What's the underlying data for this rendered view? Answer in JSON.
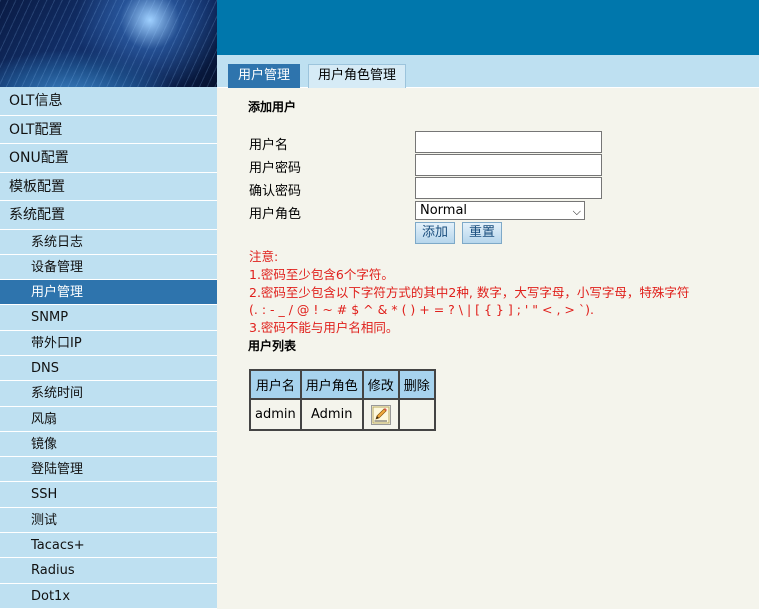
{
  "sidebar": {
    "main_items": [
      "OLT信息",
      "OLT配置",
      "ONU配置",
      "模板配置",
      "系统配置"
    ],
    "sub_items": [
      "系统日志",
      "设备管理",
      "用户管理",
      "SNMP",
      "带外口IP",
      "DNS",
      "系统时间",
      "风扇",
      "镜像",
      "登陆管理",
      "SSH",
      "测试",
      "Tacacs+",
      "Radius",
      "Dot1x"
    ],
    "active_sub": "用户管理"
  },
  "tabs": [
    {
      "label": "用户管理",
      "active": true
    },
    {
      "label": "用户角色管理",
      "active": false
    }
  ],
  "add_user": {
    "title": "添加用户",
    "username_label": "用户名",
    "username_value": "",
    "password_label": "用户密码",
    "password_value": "",
    "confirm_label": "确认密码",
    "confirm_value": "",
    "role_label": "用户角色",
    "role_selected": "Normal",
    "add_button": "添加",
    "reset_button": "重置"
  },
  "notes": [
    "注意:",
    "1.密码至少包含6个字符。",
    "2.密码至少包含以下字符方式的其中2种, 数字，大写字母，小写字母，特殊字符",
    "(. : - _ / @ ! ~ # $ ^ & * ( ) + = ? \\ | [ { } ] ; ' \" < , > `).",
    "3.密码不能与用户名相同。"
  ],
  "user_list": {
    "title": "用户列表",
    "headers": [
      "用户名",
      "用户角色",
      "修改",
      "删除"
    ],
    "rows": [
      {
        "username": "admin",
        "role": "Admin"
      }
    ]
  },
  "colors": {
    "banner": "#0077ac",
    "sidebar_bg": "#bee0f1",
    "active_item": "#2e74ad",
    "content_bg": "#f4f4ec",
    "note_red": "#e0201c",
    "table_header": "#a7d3ee"
  },
  "icons": {
    "edit": "pencil-edit-icon",
    "dropdown": "chevron-down-icon"
  }
}
